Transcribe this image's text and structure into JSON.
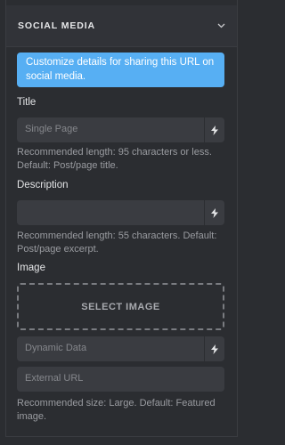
{
  "section": {
    "title": "SOCIAL MEDIA",
    "toggle_icon": "chevron-down-icon"
  },
  "info_message": "Customize details for sharing this URL on social media.",
  "title_field": {
    "label": "Title",
    "placeholder": "Single Page",
    "help": "Recommended length: 95 characters or less. Default: Post/page title."
  },
  "description_field": {
    "label": "Description",
    "placeholder": "",
    "help": "Recommended length: 55 characters. Default: Post/page excerpt."
  },
  "image_field": {
    "label": "Image",
    "select_label": "SELECT IMAGE",
    "dynamic_placeholder": "Dynamic Data",
    "external_placeholder": "External URL",
    "help": "Recommended size: Large. Default: Featured image."
  },
  "colors": {
    "info_bg": "#57aff3",
    "panel_bg": "#2b2d31",
    "field_bg": "#3a3c41"
  }
}
